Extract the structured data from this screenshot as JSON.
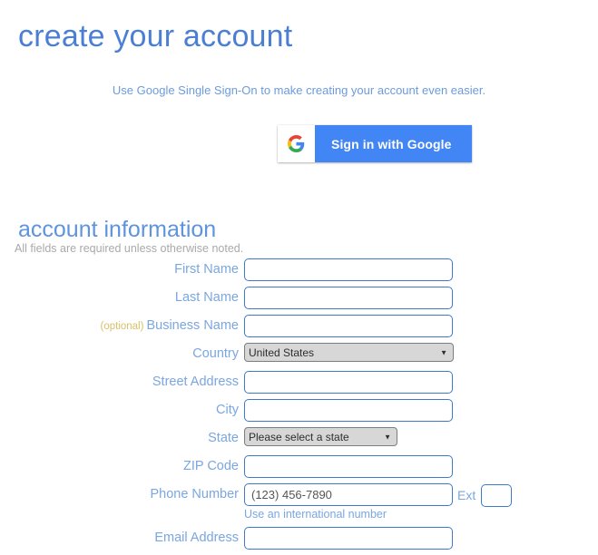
{
  "page": {
    "title": "create your account",
    "sso_text": "Use Google Single Sign-On to make creating your account even easier.",
    "accent_blue": "#4a7fd4",
    "google_blue": "#4285f4",
    "optional_color": "#d8c168"
  },
  "google_button": {
    "label": "Sign in with Google",
    "icon": "google-g-icon"
  },
  "account_section": {
    "heading": "account information",
    "required_note": "All fields are required unless otherwise noted."
  },
  "fields": [
    {
      "label": "First Name",
      "optional": "",
      "type": "text",
      "value": "",
      "placeholder": ""
    },
    {
      "label": "Last Name",
      "optional": "",
      "type": "text",
      "value": "",
      "placeholder": ""
    },
    {
      "label": "Business Name",
      "optional": "(optional)",
      "type": "text",
      "value": "",
      "placeholder": ""
    },
    {
      "label": "Country",
      "optional": "",
      "type": "select",
      "value": "United States"
    },
    {
      "label": "Street Address",
      "optional": "",
      "type": "text",
      "value": "",
      "placeholder": ""
    },
    {
      "label": "City",
      "optional": "",
      "type": "text",
      "value": "",
      "placeholder": ""
    },
    {
      "label": "State",
      "optional": "",
      "type": "select",
      "value": "Please select a state"
    },
    {
      "label": "ZIP Code",
      "optional": "",
      "type": "text",
      "value": "",
      "placeholder": ""
    }
  ],
  "phone_row": {
    "label": "Phone Number",
    "placeholder": "(123) 456-7890",
    "value": "",
    "ext_label": "Ext",
    "ext_value": "",
    "helper_link": "Use an international number"
  },
  "email_row": {
    "label": "Email Address",
    "value": "",
    "placeholder": ""
  }
}
